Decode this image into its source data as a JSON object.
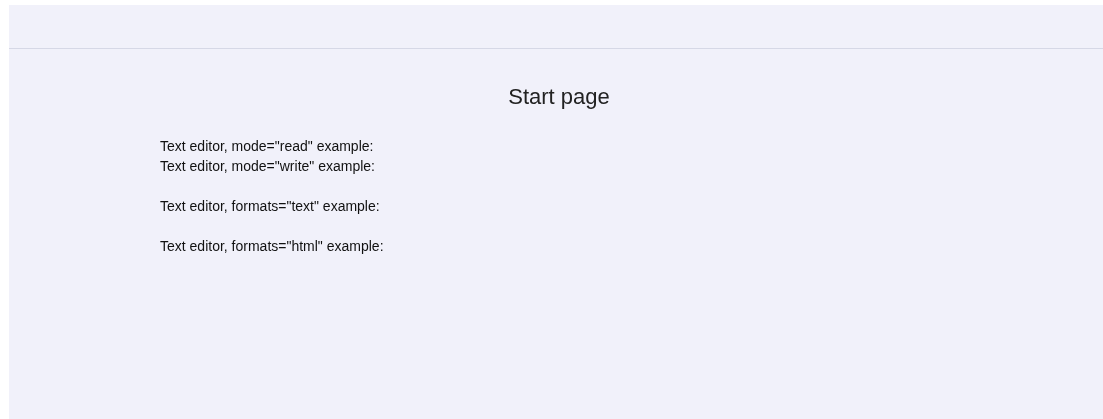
{
  "page": {
    "title": "Start page",
    "sections": [
      [
        "Text editor, mode=\"read\" example:",
        "Text editor, mode=\"write\" example:"
      ],
      [
        "Text editor, formats=\"text\" example:"
      ],
      [
        "Text editor, formats=\"html\" example:"
      ]
    ]
  }
}
